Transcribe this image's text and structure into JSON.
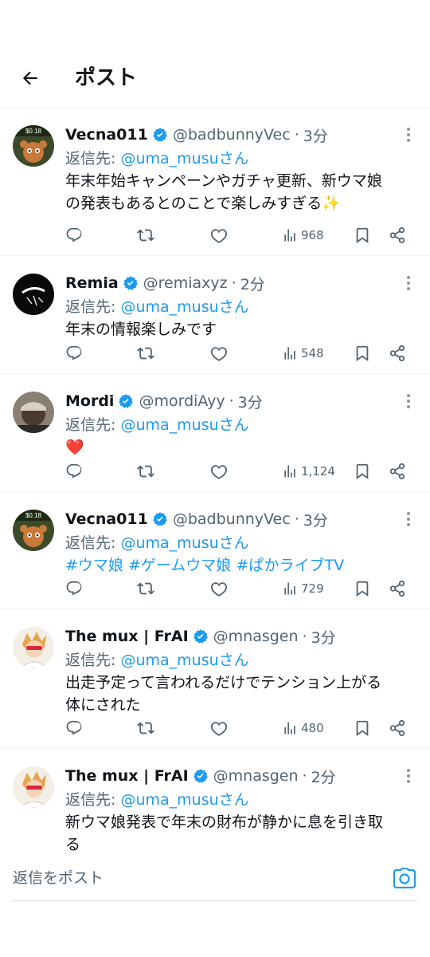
{
  "header": {
    "title": "ポスト"
  },
  "tweets": [
    {
      "name": "Vecna011",
      "handle": "@badbunnyVec",
      "time": "3分",
      "reply_prefix": "返信先: ",
      "reply_mention": "@uma_musuさん",
      "text_lines": [
        "年末年始キャンペーンやガチャ更新、新ウマ娘",
        "の発表もあるとのことで楽しみすぎる✨"
      ],
      "views": "968",
      "avatar_caption": "$0.18"
    },
    {
      "name": "Remia",
      "handle": "@remiaxyz",
      "time": "2分",
      "reply_prefix": "返信先: ",
      "reply_mention": "@uma_musuさん",
      "text_lines": [
        "年末の情報楽しみです"
      ],
      "views": "548"
    },
    {
      "name": "Mordi",
      "handle": "@mordiAyy",
      "time": "3分",
      "reply_prefix": "返信先: ",
      "reply_mention": "@uma_musuさん",
      "text_lines": [
        "❤️"
      ],
      "views": "1,124"
    },
    {
      "name": "Vecna011",
      "handle": "@badbunnyVec",
      "time": "3分",
      "reply_prefix": "返信先: ",
      "reply_mention": "@uma_musuさん",
      "text_lines": [
        "#ウマ娘 #ゲームウマ娘 #ぱかライブTV"
      ],
      "views": "729",
      "avatar_caption": "$0.18"
    },
    {
      "name": "The mux | FrAI",
      "handle": "@mnasgen",
      "time": "3分",
      "reply_prefix": "返信先: ",
      "reply_mention": "@uma_musuさん",
      "text_lines": [
        "出走予定って言われるだけでテンション上がる",
        "体にされた"
      ],
      "views": "480"
    },
    {
      "name": "The mux | FrAI",
      "handle": "@mnasgen",
      "time": "2分",
      "reply_prefix": "返信先: ",
      "reply_mention": "@uma_musuさん",
      "text_lines": [
        "新ウマ娘発表で年末の財布が静かに息を引き取",
        "る"
      ]
    }
  ],
  "reply_bar": {
    "placeholder": "返信をポスト"
  },
  "colors": {
    "accent": "#1d9bf0",
    "secondary_text": "#536471",
    "primary_text": "#0f1419",
    "divider": "#eff3f4",
    "heart": "#e0245e"
  },
  "icons": [
    "back-arrow-icon",
    "verified-badge-icon",
    "more-dots-icon",
    "reply-icon",
    "retweet-icon",
    "like-icon",
    "views-icon",
    "bookmark-icon",
    "share-icon",
    "camera-icon"
  ]
}
